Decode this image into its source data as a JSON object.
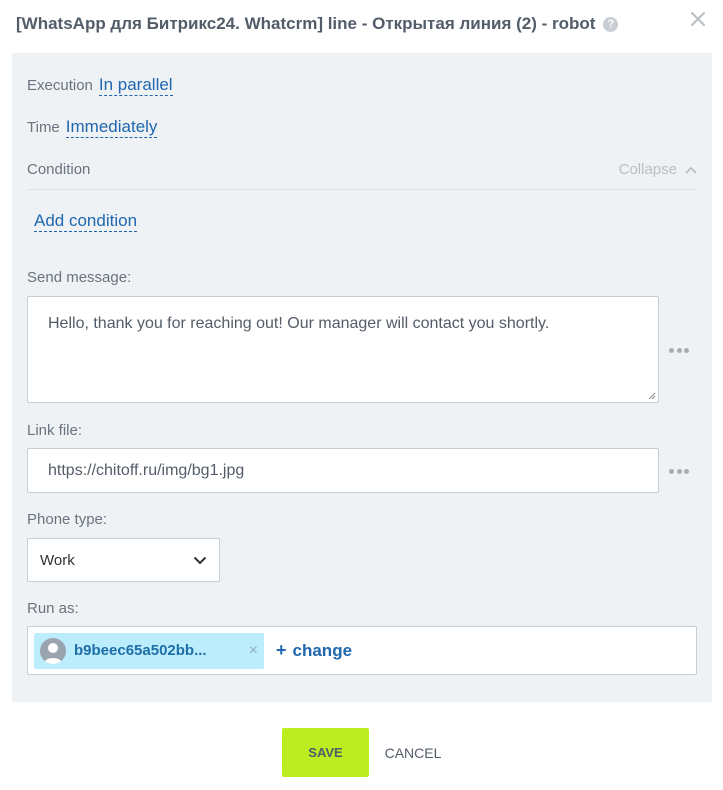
{
  "dialog": {
    "title": "[WhatsApp для Битрикс24. Whatcrm] line - Открытая линия (2) - robot",
    "help_glyph": "?",
    "close_icon": "close-icon"
  },
  "execution": {
    "label": "Execution",
    "value": "In parallel"
  },
  "time": {
    "label": "Time",
    "value": "Immediately"
  },
  "condition": {
    "label": "Condition",
    "collapse_label": "Collapse",
    "add_label": "Add condition"
  },
  "send_message": {
    "label": "Send message:",
    "value": "Hello, thank you for reaching out! Our manager will contact you shortly."
  },
  "link_file": {
    "label": "Link file:",
    "value": "https://chitoff.ru/img/bg1.jpg"
  },
  "phone_type": {
    "label": "Phone type:",
    "selected": "Work"
  },
  "run_as": {
    "label": "Run as:",
    "user": "b9beec65a502bb...",
    "remove_glyph": "×",
    "change_plus": "+",
    "change_label": "change"
  },
  "footer": {
    "save_label": "SAVE",
    "cancel_label": "CANCEL"
  },
  "colors": {
    "panel_bg": "#eef2f4",
    "link": "#2067b0",
    "save_button": "#bbed21",
    "user_tag": "#bcedfc"
  }
}
